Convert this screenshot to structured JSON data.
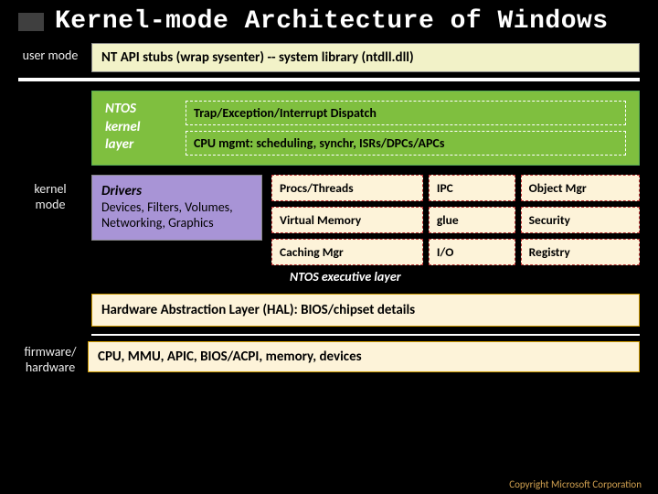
{
  "title": "Kernel-mode Architecture of Windows",
  "labels": {
    "user_mode": "user mode",
    "kernel_mode": "kernel mode",
    "firmware_hardware": "firmware/ hardware"
  },
  "user_box": "NT API stubs (wrap sysenter) -- system library (ntdll.dll)",
  "ntos_kernel": {
    "label": "NTOS kernel layer",
    "rows": [
      "Trap/Exception/Interrupt Dispatch",
      "CPU mgmt: scheduling, synchr, ISRs/DPCs/APCs"
    ]
  },
  "drivers": {
    "title": "Drivers",
    "body": "Devices, Filters, Volumes, Networking, Graphics"
  },
  "exec": {
    "cells": [
      "Procs/Threads",
      "IPC",
      "Object Mgr",
      "Virtual Memory",
      "glue",
      "Security",
      "Caching Mgr",
      "I/O",
      "Registry"
    ],
    "caption": "NTOS executive layer"
  },
  "hal": "Hardware Abstraction Layer (HAL):  BIOS/chipset details",
  "fw": "CPU, MMU, APIC, BIOS/ACPI, memory, devices",
  "copyright": "Copyright Microsoft Corporation"
}
